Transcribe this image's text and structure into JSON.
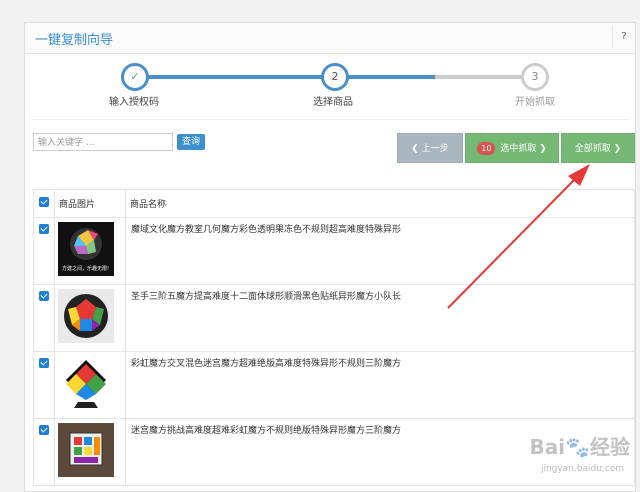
{
  "header": {
    "title": "一键复制向导",
    "help": "?"
  },
  "steps": [
    {
      "label": "输入授权码",
      "number": "✓",
      "state": "done"
    },
    {
      "label": "选择商品",
      "number": "2",
      "state": "active"
    },
    {
      "label": "开始抓取",
      "number": "3",
      "state": "pending"
    }
  ],
  "search": {
    "placeholder": "输入关键字 ...",
    "button": "查询"
  },
  "actions": {
    "prev": "上一步",
    "selected_count": "10",
    "selected": "选中抓取",
    "all": "全部抓取"
  },
  "table": {
    "headers": [
      "商品图片",
      "商品名称"
    ],
    "rows": [
      {
        "name": "魔域文化魔方教室几何魔方彩色透明果冻色不规则超高难度特殊异形",
        "thumb_caption": "方建之间，乐趣无限!"
      },
      {
        "name": "圣手三阶五魔方提高难度十二面体球形顺滑黑色贴纸异形魔方小队长"
      },
      {
        "name": "彩虹魔方交叉混色迷宫魔方超难绝版高难度特殊异形不规则三阶魔方"
      },
      {
        "name": "迷宫魔方挑战高难度超难彩虹魔方不规则绝版特殊异形魔方三阶魔方"
      }
    ]
  },
  "watermark": {
    "brand": "Bai",
    "brand_tail": "经验",
    "url": "jingyan.baidu.com"
  },
  "colors": {
    "primary": "#3a8fd0",
    "success": "#74b874",
    "arrow": "#e53935"
  }
}
